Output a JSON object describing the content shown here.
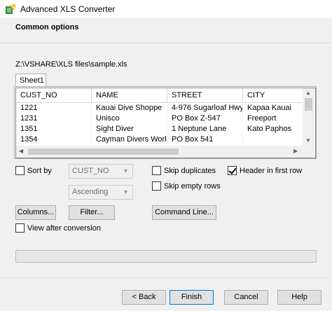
{
  "window": {
    "title": "Advanced XLS Converter"
  },
  "section": {
    "title": "Common options"
  },
  "file": {
    "path": "Z:\\VSHARE\\XLS files\\sample.xls"
  },
  "sheet_tabs": [
    "Sheet1"
  ],
  "table": {
    "columns": [
      "CUST_NO",
      "NAME",
      "STREET",
      "CITY"
    ],
    "rows": [
      [
        "1221",
        "Kauai Dive Shoppe",
        "4-976 Sugarloaf Hwy",
        "Kapaa Kauai"
      ],
      [
        "1231",
        "Unisco",
        "PO Box Z-547",
        "Freeport"
      ],
      [
        "1351",
        "Sight Diver",
        "1 Neptune Lane",
        "Kato Paphos"
      ],
      [
        "1354",
        "Cayman Divers Worl...",
        "PO Box 541",
        ""
      ]
    ]
  },
  "options": {
    "sort_by": {
      "label": "Sort by",
      "checked": false
    },
    "sort_field": "CUST_NO",
    "sort_order": "Ascending",
    "skip_duplicates": {
      "label": "Skip duplicates",
      "checked": false
    },
    "header_first_row": {
      "label": "Header in first row",
      "checked": true
    },
    "skip_empty_rows": {
      "label": "Skip empty rows",
      "checked": false
    },
    "view_after": {
      "label": "View after conversion",
      "checked": false
    }
  },
  "buttons": {
    "columns": "Columns...",
    "filter": "Filter...",
    "command_line": "Command Line...",
    "back": "< Back",
    "finish": "Finish",
    "cancel": "Cancel",
    "help": "Help"
  },
  "icons": {
    "app": "app-logo-icon",
    "combo": "chevron-down-icon",
    "scroll_up": "arrow-up-icon",
    "scroll_down": "arrow-down-icon",
    "scroll_left": "arrow-left-icon",
    "scroll_right": "arrow-right-icon"
  },
  "colors": {
    "default_button_border": "#0078d7",
    "header_panel": "#f0f0f0"
  }
}
